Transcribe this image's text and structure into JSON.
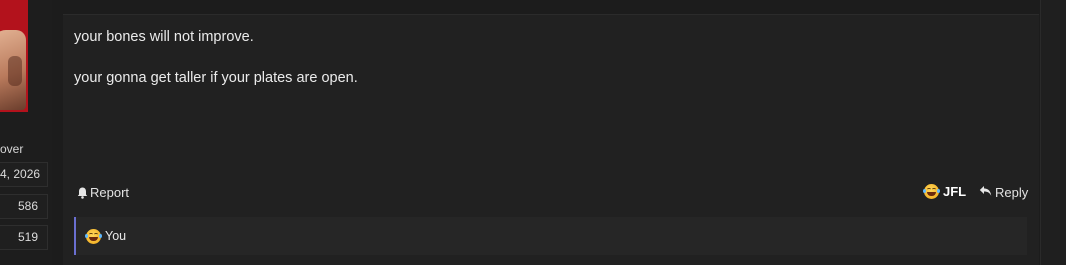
{
  "user": {
    "title_fragment": "over",
    "stats": [
      "4, 2026",
      "586",
      "519"
    ]
  },
  "post": {
    "paragraphs": [
      "your bones will not improve.",
      "your gonna get taller if your plates are open."
    ],
    "actions": {
      "report_label": "Report",
      "reaction_label": "JFL",
      "reply_label": "Reply"
    },
    "reactions": {
      "by_label": "You",
      "accent_color": "#6a6fd0"
    },
    "icons": [
      "bell-icon",
      "laugh-cry-emoji-icon",
      "reply-arrow-icon"
    ]
  }
}
